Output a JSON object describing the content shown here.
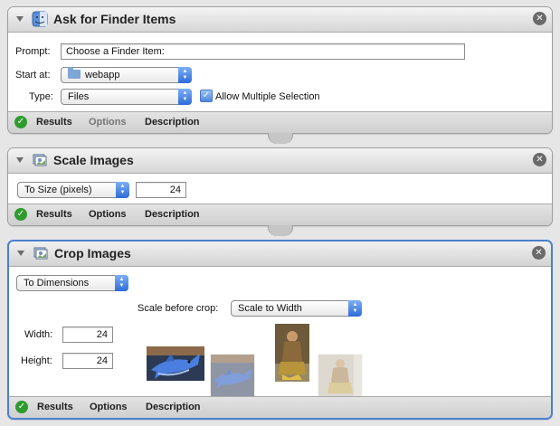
{
  "ask_for_finder_items": {
    "title": "Ask for Finder Items",
    "prompt_label": "Prompt:",
    "prompt_value": "Choose a Finder Item:",
    "start_at_label": "Start at:",
    "start_at_value": "webapp",
    "type_label": "Type:",
    "type_value": "Files",
    "allow_multiple_label": "Allow Multiple Selection",
    "allow_multiple_checked": true
  },
  "scale_images": {
    "title": "Scale Images",
    "mode_value": "To Size (pixels)",
    "size_value": "24"
  },
  "crop_images": {
    "title": "Crop Images",
    "mode_value": "To Dimensions",
    "scale_before_crop_label": "Scale before crop:",
    "scale_before_crop_value": "Scale to Width",
    "width_label": "Width:",
    "width_value": "24",
    "height_label": "Height:",
    "height_value": "24"
  },
  "footer": {
    "results": "Results",
    "options": "Options",
    "description": "Description"
  },
  "icons": {
    "close": "close-icon",
    "results_ok": "check-circle-icon",
    "disclosure": "disclosure-triangle-icon",
    "finder": "finder-icon",
    "preview": "preview-icon",
    "folder": "folder-icon"
  },
  "colors": {
    "selection_border": "#4a7fd0",
    "popup_arrow": "#2e6bd8",
    "success_green": "#2f9b2f"
  }
}
